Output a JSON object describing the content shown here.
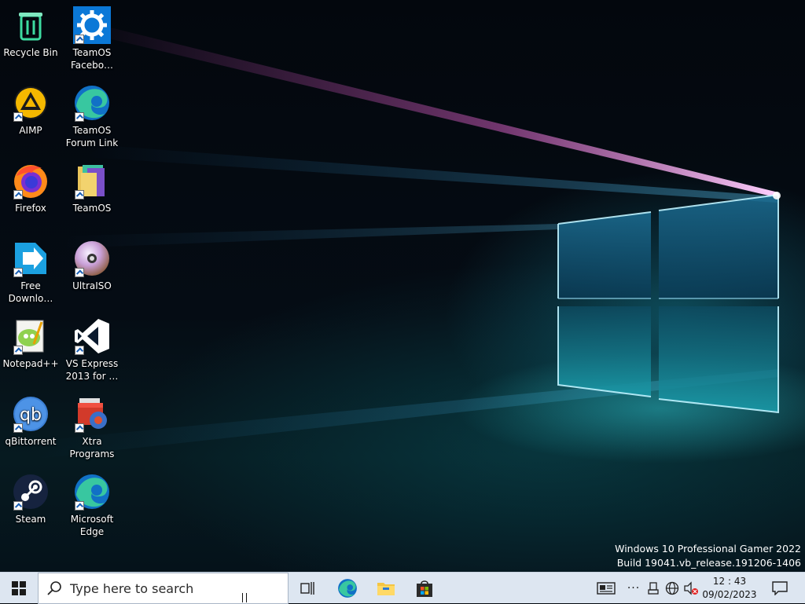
{
  "desktop": {
    "icons": [
      {
        "label": "Recycle Bin",
        "icon": "recycle-bin-icon",
        "shortcut": false
      },
      {
        "label": "TeamOS\nFacebo…",
        "icon": "settings-gear-icon",
        "shortcut": true
      },
      {
        "label": "AIMP",
        "icon": "aimp-icon",
        "shortcut": true
      },
      {
        "label": "TeamOS\nForum Link",
        "icon": "edge-icon",
        "shortcut": true
      },
      {
        "label": "Firefox",
        "icon": "firefox-icon",
        "shortcut": true
      },
      {
        "label": "TeamOS",
        "icon": "teamos-folder-icon",
        "shortcut": true
      },
      {
        "label": "Free\nDownlo…",
        "icon": "free-download-manager-icon",
        "shortcut": true
      },
      {
        "label": "UltraISO",
        "icon": "ultraiso-disc-icon",
        "shortcut": true
      },
      {
        "label": "Notepad++",
        "icon": "notepad-plus-plus-icon",
        "shortcut": true
      },
      {
        "label": "VS Express\n2013 for …",
        "icon": "visual-studio-icon",
        "shortcut": true
      },
      {
        "label": "qBittorrent",
        "icon": "qbittorrent-icon",
        "shortcut": true
      },
      {
        "label": "Xtra\nPrograms",
        "icon": "xtra-programs-icon",
        "shortcut": true
      },
      {
        "label": "Steam",
        "icon": "steam-icon",
        "shortcut": true
      },
      {
        "label": "Microsoft\nEdge",
        "icon": "edge-icon",
        "shortcut": true
      }
    ],
    "watermark": {
      "line1": "Windows 10 Professional Gamer 2022",
      "line2": "Build 19041.vb_release.191206-1406"
    }
  },
  "taskbar": {
    "search_placeholder": "Type here to search",
    "pinned": [
      {
        "icon": "task-view-icon"
      },
      {
        "icon": "edge-icon"
      },
      {
        "icon": "file-explorer-icon"
      },
      {
        "icon": "microsoft-store-icon"
      }
    ],
    "tray": {
      "icons": [
        "news-widget-icon",
        "overflow-dots-icon",
        "usb-device-icon",
        "network-globe-icon",
        "volume-muted-icon"
      ],
      "time": "12 : 43",
      "date": "09/02/2023"
    }
  },
  "colors": {
    "taskbar_bg": "#dde6f1",
    "wallpaper_pink": "#e05ab8",
    "wallpaper_cyan": "#5fe0f0",
    "windows_blue": "#0078d7"
  }
}
